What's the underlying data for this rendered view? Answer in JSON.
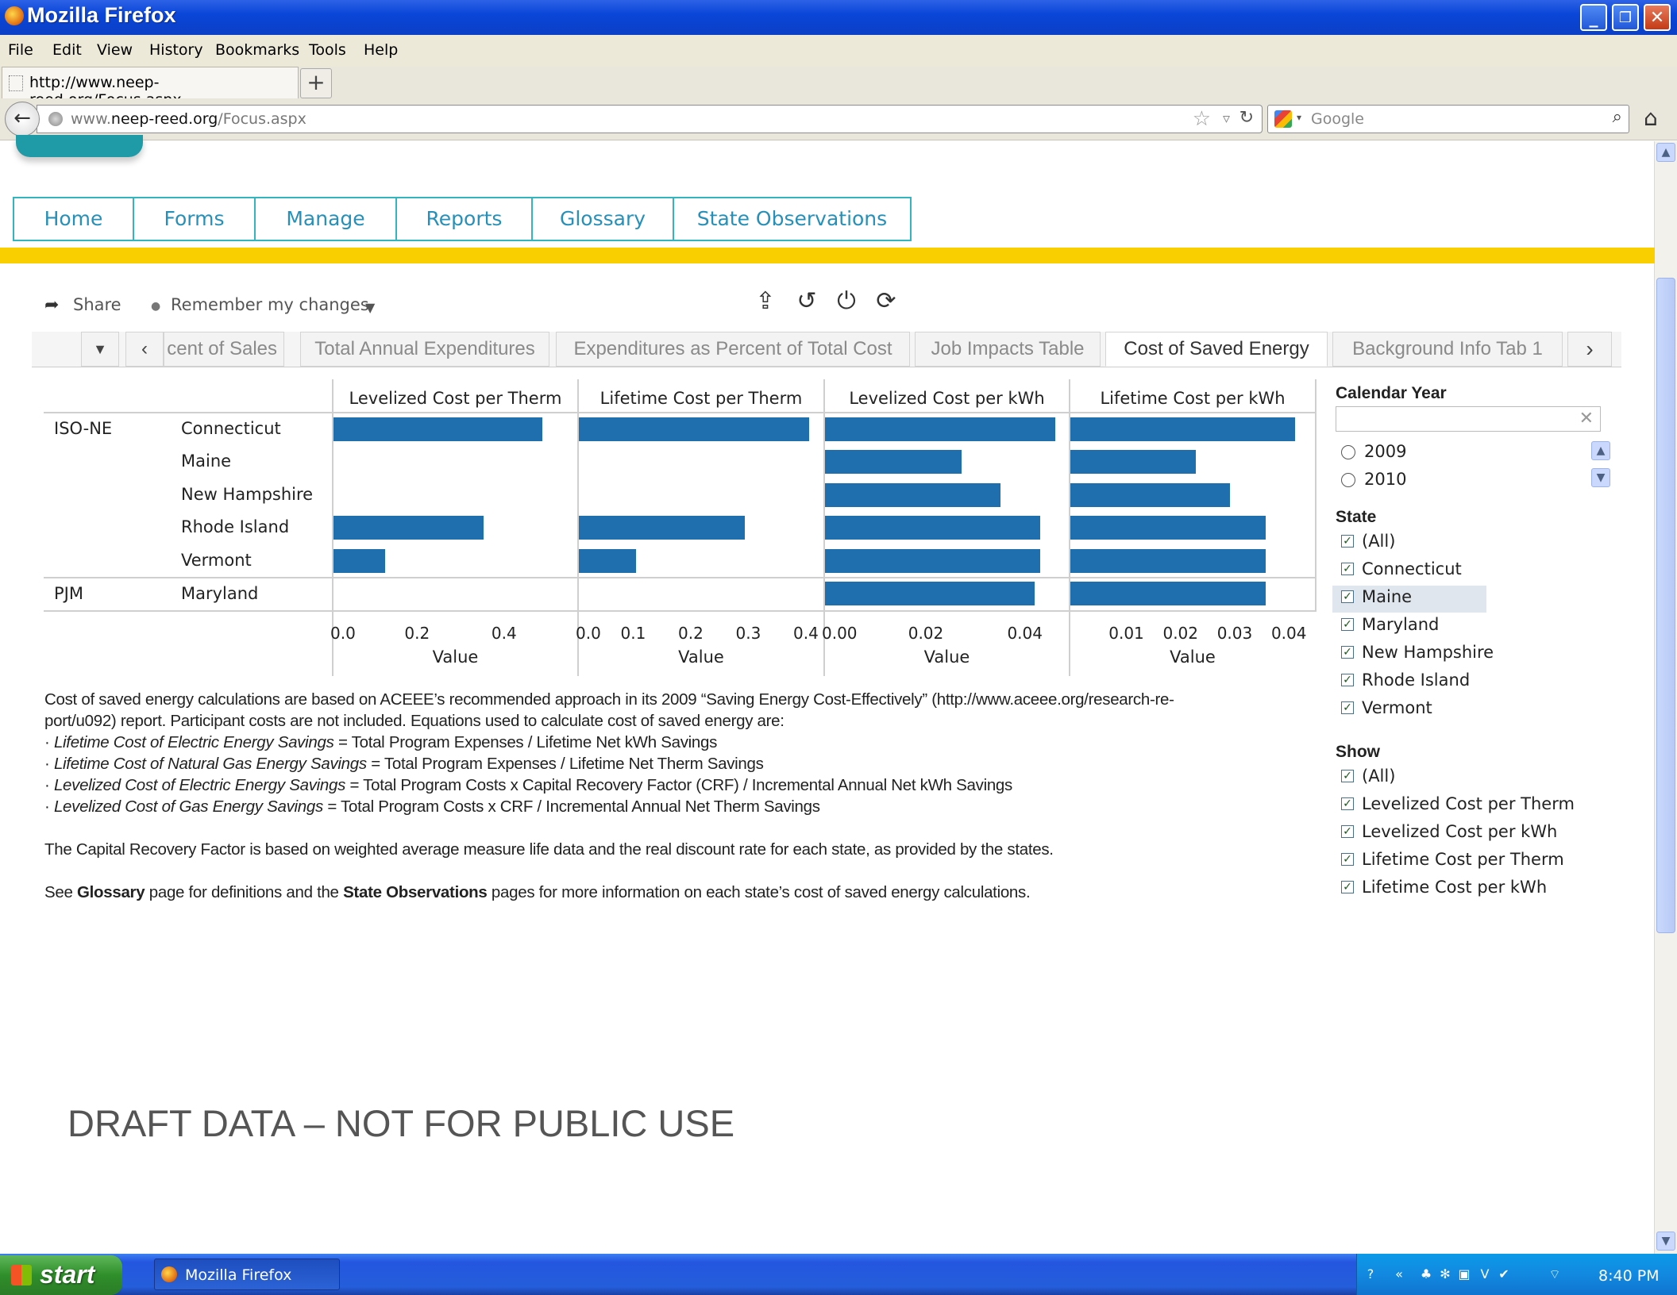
{
  "window": {
    "title": "Mozilla Firefox",
    "buttons": {
      "minimize": "_",
      "maximize": "❐",
      "close": "✕"
    }
  },
  "menu": [
    "File",
    "Edit",
    "View",
    "History",
    "Bookmarks",
    "Tools",
    "Help"
  ],
  "browser_tab": {
    "label": "http://www.neep-reed.org/Focus.aspx",
    "new_tab": "+"
  },
  "navbar": {
    "url_prefix": "www.",
    "url_domain": "neep-reed.org",
    "url_path": "/Focus.aspx",
    "search_placeholder": "Google"
  },
  "site_nav": [
    "Home",
    "Forms",
    "Manage",
    "Reports",
    "Glossary",
    "State Observations"
  ],
  "toolbar": {
    "share": "Share",
    "remember": "Remember my changes"
  },
  "sheet_tabs": [
    {
      "label": "cent of Sales",
      "active": false
    },
    {
      "label": "Total Annual Expenditures",
      "active": false
    },
    {
      "label": "Expenditures as Percent of Total Cost",
      "active": false
    },
    {
      "label": "Job Impacts Table",
      "active": false
    },
    {
      "label": "Cost of Saved Energy",
      "active": true
    },
    {
      "label": "Background Info Tab 1",
      "active": false
    }
  ],
  "chart_data": {
    "type": "bar",
    "orientation": "horizontal",
    "colors": {
      "bar": "#1f6fae"
    },
    "regions": [
      {
        "name": "ISO-NE",
        "states": [
          "Connecticut",
          "Maine",
          "New Hampshire",
          "Rhode Island",
          "Vermont"
        ]
      },
      {
        "name": "PJM",
        "states": [
          "Maryland"
        ]
      }
    ],
    "categories": [
      "Connecticut",
      "Maine",
      "New Hampshire",
      "Rhode Island",
      "Vermont",
      "Maryland"
    ],
    "panels": [
      {
        "name": "Levelized Cost per Therm",
        "xlabel": "Value",
        "ticks": [
          "0.0",
          "0.2",
          "0.4"
        ],
        "xlim": [
          0,
          0.53
        ],
        "values": [
          0.48,
          null,
          null,
          0.345,
          0.118,
          null
        ]
      },
      {
        "name": "Lifetime Cost per Therm",
        "xlabel": "Value",
        "ticks": [
          "0.0",
          "0.1",
          "0.2",
          "0.3",
          "0.4"
        ],
        "xlim": [
          0,
          0.4
        ],
        "values": [
          0.4,
          null,
          null,
          0.288,
          0.099,
          null
        ]
      },
      {
        "name": "Levelized Cost per kWh",
        "xlabel": "Value",
        "ticks": [
          "0.00",
          "0.02",
          "0.04"
        ],
        "xlim": [
          0,
          0.0465
        ],
        "values": [
          0.0475,
          0.0275,
          0.0355,
          0.0435,
          0.0435,
          0.0423
        ]
      },
      {
        "name": "Lifetime Cost per kWh",
        "xlabel": "Value",
        "ticks": [
          "0.01",
          "0.02",
          "0.03",
          "0.04"
        ],
        "xlim": [
          0,
          0.0425
        ],
        "values": [
          0.0415,
          0.0232,
          0.0295,
          0.036,
          0.036,
          0.036
        ]
      }
    ]
  },
  "notes": {
    "p1a": "Cost of saved energy calculations are based on ACEEE’s recommended approach in its 2009 “Saving Energy Cost-Effectively” (http://www.aceee.org/research-re-",
    "p1b": "port/u092) report. Participant costs are not included.  Equations used to calculate cost of saved energy are:",
    "eq1_term": "Lifetime Cost of Electric Energy Savings",
    "eq1_def": " = Total Program Expenses / Lifetime Net kWh Savings",
    "eq2_term": "Lifetime Cost of Natural Gas Energy Savings",
    "eq2_def": " = Total Program Expenses / Lifetime Net Therm Savings",
    "eq3_term": "Levelized Cost of Electric Energy Savings",
    "eq3_def": "  = Total Program Costs x Capital Recovery Factor (CRF) / Incremental Annual Net kWh Savings",
    "eq4_term": "Levelized Cost of Gas Energy Savings",
    "eq4_def": " = Total Program Costs x CRF / Incremental Annual Net Therm Savings",
    "bullet": "· ",
    "p2": "The Capital Recovery Factor is based on weighted average measure life data and the real discount rate for each state, as provided by the states.",
    "p3_a": "See ",
    "p3_b": "Glossary",
    "p3_c": " page for definitions and the ",
    "p3_d": "State Observations",
    "p3_e": " pages for more information on each state’s cost of saved energy calculations."
  },
  "filters": {
    "calendar_year": {
      "title": "Calendar Year",
      "options": [
        "2009",
        "2010"
      ]
    },
    "state": {
      "title": "State",
      "options": [
        "(All)",
        "Connecticut",
        "Maine",
        "Maryland",
        "New Hampshire",
        "Rhode Island",
        "Vermont"
      ],
      "highlighted": "Maine"
    },
    "show": {
      "title": "Show",
      "options": [
        "(All)",
        "Levelized Cost per Therm",
        "Levelized Cost per kWh",
        "Lifetime Cost per Therm",
        "Lifetime Cost per kWh"
      ]
    }
  },
  "draft_notice": "DRAFT DATA – NOT FOR PUBLIC USE",
  "taskbar": {
    "start": "start",
    "item": "Mozilla Firefox",
    "clock": "8:40 PM"
  }
}
